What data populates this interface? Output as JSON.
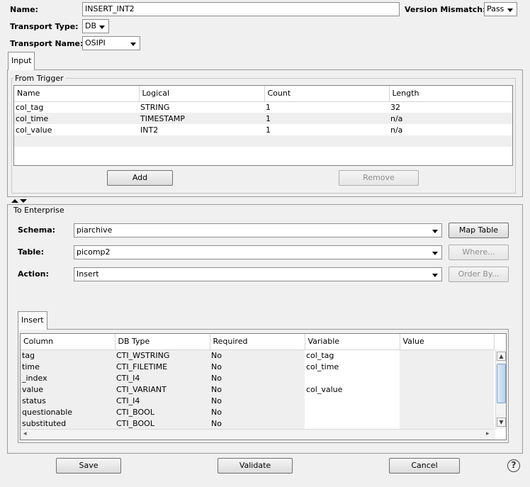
{
  "header": {
    "name_label": "Name:",
    "name_value": "INSERT_INT2",
    "version_mismatch_label": "Version Mismatch:",
    "version_mismatch_value": "Pass",
    "transport_type_label": "Transport Type:",
    "transport_type_value": "DB",
    "transport_name_label": "Transport Name:",
    "transport_name_value": "OSIPI"
  },
  "input_tab": {
    "label": "Input",
    "from_trigger_title": "From Trigger",
    "columns": [
      "Name",
      "Logical",
      "Count",
      "Length"
    ],
    "rows": [
      [
        "col_tag",
        "STRING",
        "1",
        "32"
      ],
      [
        "col_time",
        "TIMESTAMP",
        "1",
        "n/a"
      ],
      [
        "col_value",
        "INT2",
        "1",
        "n/a"
      ]
    ],
    "add_label": "Add",
    "remove_label": "Remove"
  },
  "enterprise": {
    "title": "To Enterprise",
    "schema_label": "Schema:",
    "schema_value": "piarchive",
    "table_label": "Table:",
    "table_value": "picomp2",
    "action_label": "Action:",
    "action_value": "Insert",
    "map_table_label": "Map Table",
    "where_label": "Where...",
    "order_by_label": "Order By...",
    "insert_tab_label": "Insert",
    "columns": [
      "Column",
      "DB Type",
      "Required",
      "Variable",
      "Value"
    ],
    "rows": [
      [
        "tag",
        "CTI_WSTRING",
        "No",
        "col_tag",
        ""
      ],
      [
        "time",
        "CTI_FILETIME",
        "No",
        "col_time",
        ""
      ],
      [
        "_index",
        "CTI_I4",
        "No",
        "",
        ""
      ],
      [
        "value",
        "CTI_VARIANT",
        "No",
        "col_value",
        ""
      ],
      [
        "status",
        "CTI_I4",
        "No",
        "",
        ""
      ],
      [
        "questionable",
        "CTI_BOOL",
        "No",
        "",
        ""
      ],
      [
        "substituted",
        "CTI_BOOL",
        "No",
        "",
        ""
      ]
    ]
  },
  "footer": {
    "save_label": "Save",
    "validate_label": "Validate",
    "cancel_label": "Cancel",
    "help_glyph": "?"
  },
  "icons": {
    "dropdown": "chevron-down-icon",
    "splitter": "splitter-arrows-icon",
    "help": "help-icon"
  },
  "colors": {
    "background": "#f0f0f0",
    "alt_row": "#efefef",
    "disabled_text": "#8d8d8d"
  }
}
